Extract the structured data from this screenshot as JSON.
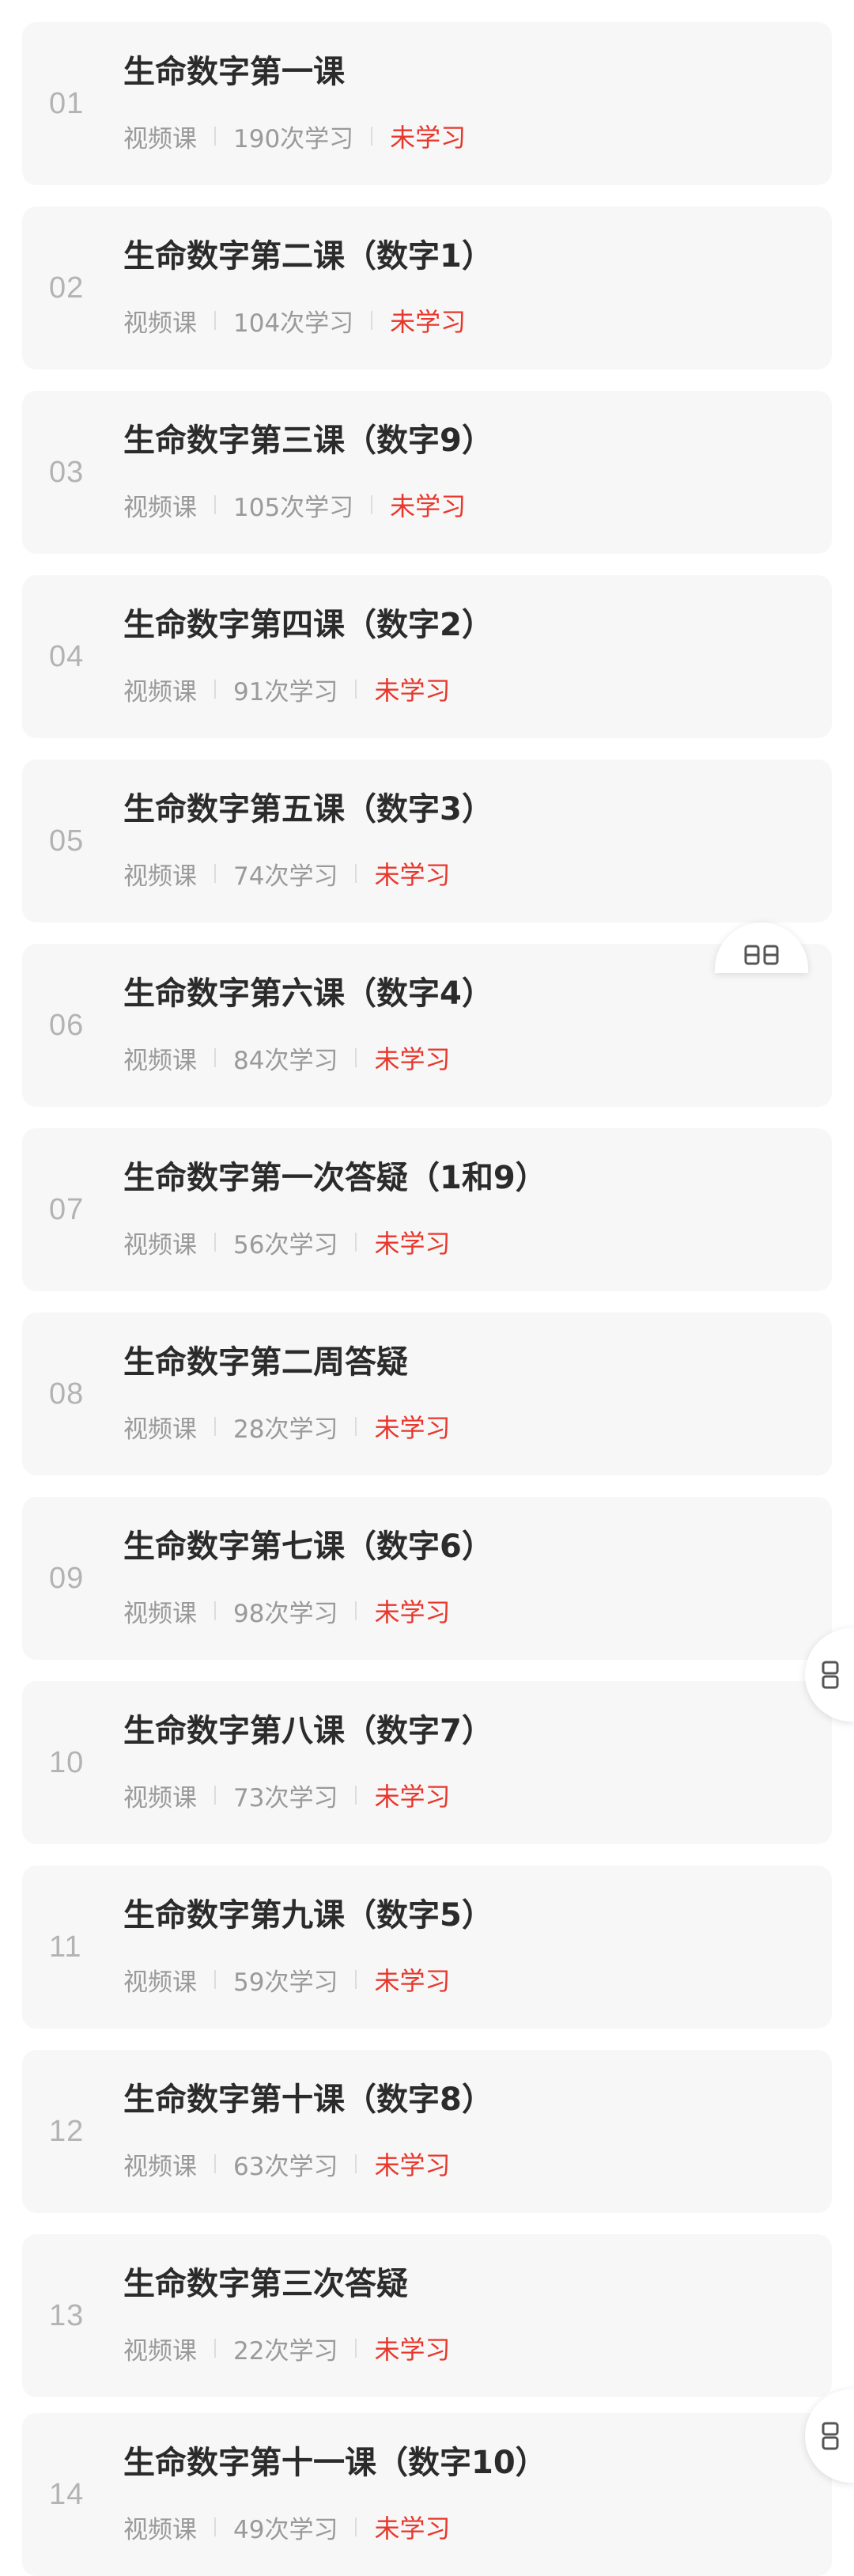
{
  "lessons": [
    {
      "num": "01",
      "title": "生命数字第一课",
      "type": "视频课",
      "count": "190次学习",
      "status": "未学习"
    },
    {
      "num": "02",
      "title": "生命数字第二课（数字1）",
      "type": "视频课",
      "count": "104次学习",
      "status": "未学习"
    },
    {
      "num": "03",
      "title": "生命数字第三课（数字9）",
      "type": "视频课",
      "count": "105次学习",
      "status": "未学习"
    },
    {
      "num": "04",
      "title": "生命数字第四课（数字2）",
      "type": "视频课",
      "count": "91次学习",
      "status": "未学习"
    },
    {
      "num": "05",
      "title": "生命数字第五课（数字3）",
      "type": "视频课",
      "count": "74次学习",
      "status": "未学习"
    },
    {
      "num": "06",
      "title": "生命数字第六课（数字4）",
      "type": "视频课",
      "count": "84次学习",
      "status": "未学习"
    },
    {
      "num": "07",
      "title": "生命数字第一次答疑（1和9）",
      "type": "视频课",
      "count": "56次学习",
      "status": "未学习"
    },
    {
      "num": "08",
      "title": "生命数字第二周答疑",
      "type": "视频课",
      "count": "28次学习",
      "status": "未学习"
    },
    {
      "num": "09",
      "title": "生命数字第七课（数字6）",
      "type": "视频课",
      "count": "98次学习",
      "status": "未学习"
    },
    {
      "num": "10",
      "title": "生命数字第八课（数字7）",
      "type": "视频课",
      "count": "73次学习",
      "status": "未学习"
    },
    {
      "num": "11",
      "title": "生命数字第九课（数字5）",
      "type": "视频课",
      "count": "59次学习",
      "status": "未学习"
    },
    {
      "num": "12",
      "title": "生命数字第十课（数字8）",
      "type": "视频课",
      "count": "63次学习",
      "status": "未学习"
    },
    {
      "num": "13",
      "title": "生命数字第三次答疑",
      "type": "视频课",
      "count": "22次学习",
      "status": "未学习"
    },
    {
      "num": "14",
      "title": "生命数字第十一课（数字10）",
      "type": "视频课",
      "count": "49次学习",
      "status": "未学习"
    }
  ],
  "floating": {
    "icon": "reader-mode-icon",
    "accent": "#e8372c"
  }
}
